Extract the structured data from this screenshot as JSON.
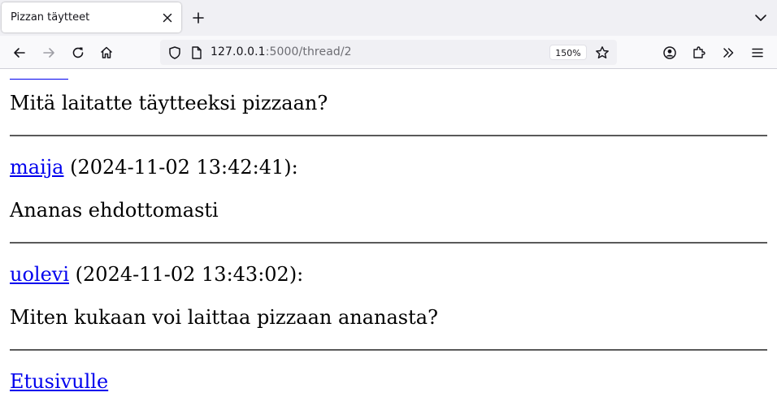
{
  "browser": {
    "tab_title": "Pizzan täytteet",
    "url_host": "127.0.0.1",
    "url_path": ":5000/thread/2",
    "zoom": "150%"
  },
  "thread": {
    "first_message": "Mitä laitatte täytteeksi pizzaan?",
    "messages": [
      {
        "user": "maija",
        "timestamp": " (2024-11-02 13:42:41):",
        "content": "Ananas ehdottomasti"
      },
      {
        "user": "uolevi",
        "timestamp": " (2024-11-02 13:43:02):",
        "content": "Miten kukaan voi laittaa pizzaan ananasta?"
      }
    ],
    "home_link": "Etusivulle"
  },
  "colors": {
    "link": "#0000ee",
    "tabstrip_bg": "#f0f0f4",
    "toolbar_bg": "#f9f9fb"
  }
}
